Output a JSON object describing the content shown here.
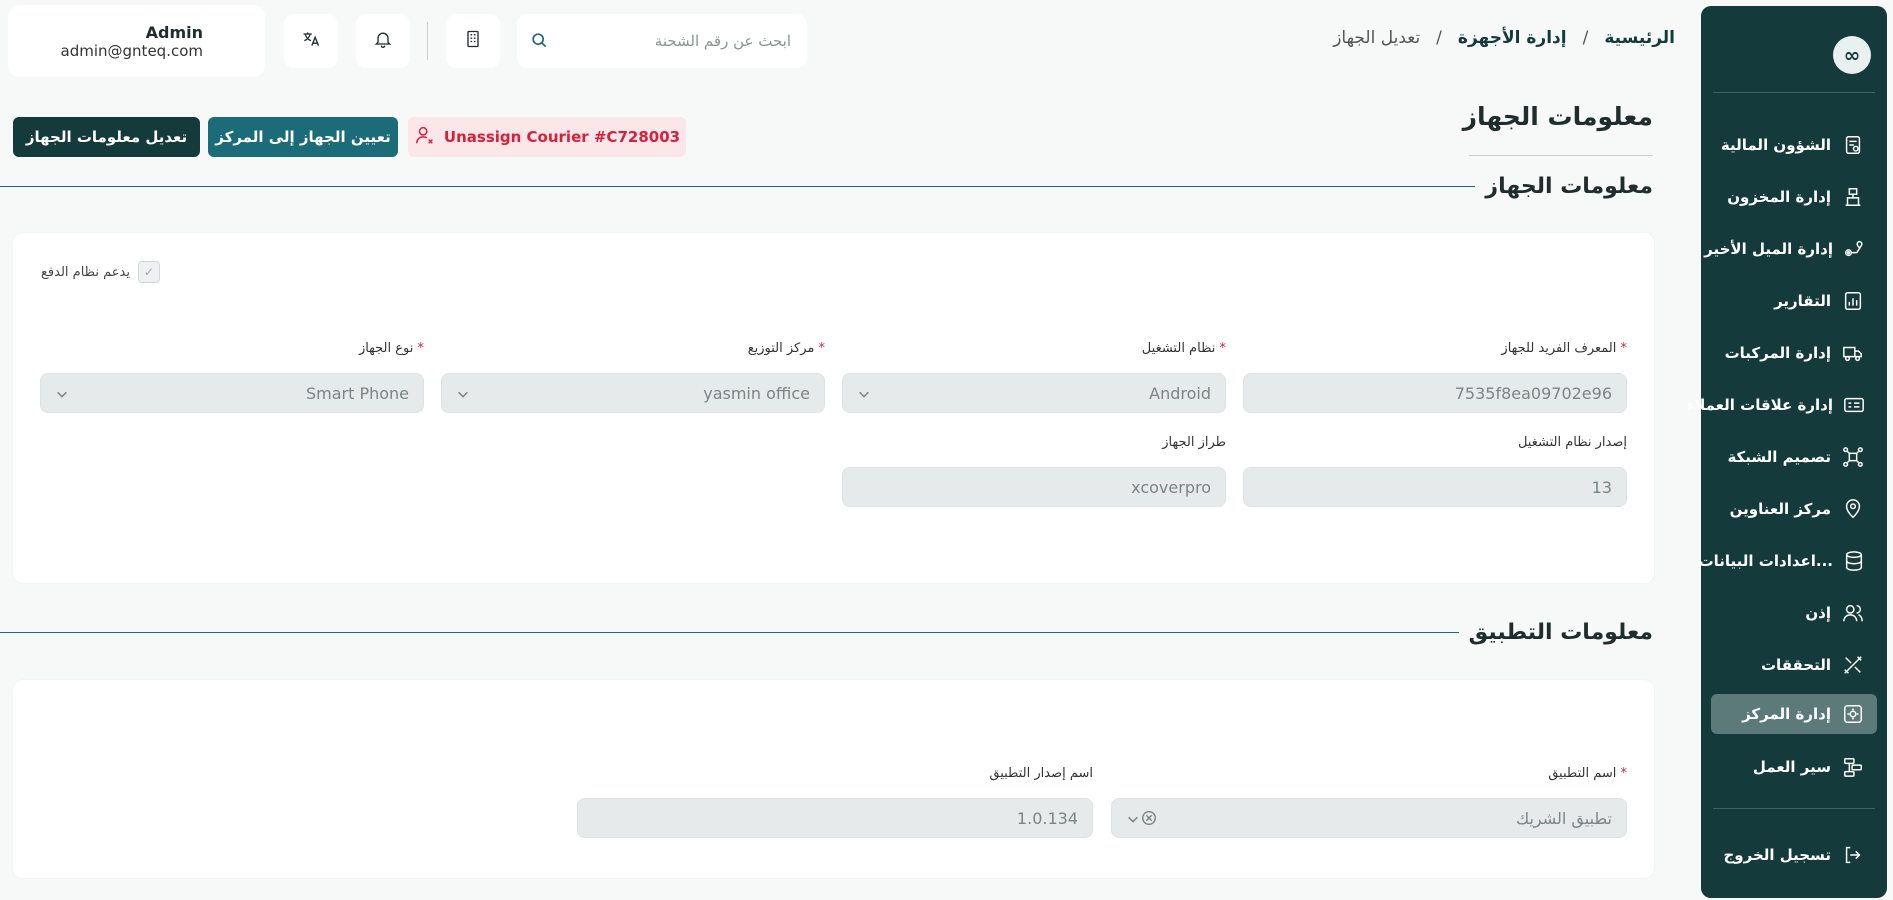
{
  "user": {
    "name": "Admin",
    "email": "admin@gnteq.com"
  },
  "search": {
    "placeholder": "ابحث عن رقم الشحنة"
  },
  "breadcrumb": {
    "home": "الرئيسية",
    "section": "إدارة الأجهزة",
    "current": "تعديل الجهاز",
    "sep": "/"
  },
  "sidebar": {
    "logo": "∞",
    "items": [
      {
        "label": "الشؤون المالية",
        "icon": "finance-icon"
      },
      {
        "label": "إدارة المخزون",
        "icon": "inventory-icon"
      },
      {
        "label": "إدارة الميل الأخير",
        "icon": "last-mile-icon"
      },
      {
        "label": "التقارير",
        "icon": "reports-icon"
      },
      {
        "label": "إدارة المركبات",
        "icon": "truck-icon"
      },
      {
        "label": "إدارة علاقات العملاء",
        "icon": "crm-icon"
      },
      {
        "label": "تصميم الشبكة",
        "icon": "network-icon"
      },
      {
        "label": "مركز العناوين",
        "icon": "location-icon"
      },
      {
        "label": "اعدادات البيانات...",
        "icon": "database-icon"
      },
      {
        "label": "إذن",
        "icon": "users-icon"
      },
      {
        "label": "التحققات",
        "icon": "validation-icon"
      },
      {
        "label": "إدارة المركز",
        "icon": "center-settings-icon",
        "active": true
      },
      {
        "label": "سير العمل",
        "icon": "workflow-icon"
      }
    ],
    "logout": "تسجيل الخروج"
  },
  "page": {
    "title": "معلومات الجهاز",
    "actions": {
      "edit": "تعديل معلومات الجهاز",
      "assign": "تعيين الجهاز إلى المركز",
      "unassign": "Unassign Courier #C728003"
    }
  },
  "device_section": {
    "title": "معلومات الجهاز",
    "payment_checkbox": {
      "label": "يدعم نظام الدفع",
      "checked": true
    },
    "fields": {
      "device_id": {
        "label": "المعرف الفريد للجهاز",
        "value": "7535f8ea09702e96",
        "required": true
      },
      "os": {
        "label": "نظام التشغيل",
        "value": "Android",
        "required": true
      },
      "distribution_center": {
        "label": "مركز التوزيع",
        "value": "yasmin office",
        "required": true
      },
      "device_type": {
        "label": "نوع الجهاز",
        "value": "Smart Phone",
        "required": true
      },
      "os_version": {
        "label": "إصدار نظام التشغيل",
        "value": "13"
      },
      "device_model": {
        "label": "طراز الجهاز",
        "value": "xcoverpro"
      }
    }
  },
  "app_section": {
    "title": "معلومات التطبيق",
    "fields": {
      "app_name": {
        "label": "اسم التطبيق",
        "value": "تطبيق الشريك",
        "required": true
      },
      "app_version": {
        "label": "اسم إصدار التطبيق",
        "value": "1.0.134"
      }
    }
  },
  "colors": {
    "sidebar": "#143a3b",
    "accent": "#1b6b78",
    "danger": "#d8203c",
    "active_item": "#5d7a7b"
  }
}
